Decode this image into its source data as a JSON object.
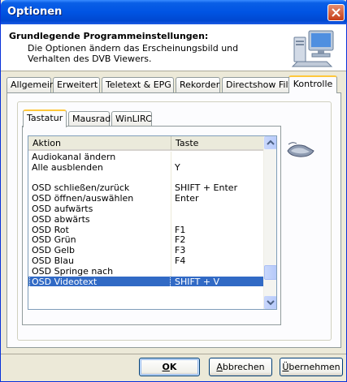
{
  "window": {
    "title": "Optionen",
    "icons": {
      "close": "close-icon",
      "header": "computer-monitor-icon",
      "keyboard": "keyboard-icon"
    }
  },
  "header": {
    "title": "Grundlegende Programmeinstellungen:",
    "description": "Die Optionen ändern das Erscheinungsbild und Verhalten des DVB Viewers."
  },
  "tabs": [
    {
      "label": "Allgemein"
    },
    {
      "label": "Erweitert"
    },
    {
      "label": "Teletext & EPG"
    },
    {
      "label": "Rekorder"
    },
    {
      "label": "Directshow Filter"
    },
    {
      "label": "Kontrolle",
      "active": true
    }
  ],
  "subtabs": [
    {
      "label": "Tastatur",
      "active": true
    },
    {
      "label": "Mausrad"
    },
    {
      "label": "WinLIRC"
    }
  ],
  "list": {
    "columns": [
      "Aktion",
      "Taste"
    ],
    "rows": [
      {
        "action": "Audiokanal ändern",
        "key": ""
      },
      {
        "action": "Alle ausblenden",
        "key": "Y"
      },
      {
        "action": "",
        "key": ""
      },
      {
        "action": "OSD schließen/zurück",
        "key": "SHIFT + Enter"
      },
      {
        "action": "OSD öffnen/auswählen",
        "key": "Enter"
      },
      {
        "action": "OSD aufwärts",
        "key": ""
      },
      {
        "action": "OSD abwärts",
        "key": ""
      },
      {
        "action": "OSD Rot",
        "key": "F1"
      },
      {
        "action": "OSD Grün",
        "key": "F2"
      },
      {
        "action": "OSD Gelb",
        "key": "F3"
      },
      {
        "action": "OSD Blau",
        "key": "F4"
      },
      {
        "action": "OSD Springe nach",
        "key": ""
      },
      {
        "action": "OSD Videotext",
        "key": "SHIFT + V",
        "selected": true
      }
    ],
    "scroll_position": 0.88
  },
  "buttons": {
    "ok": {
      "underlined": "O",
      "rest": "K"
    },
    "cancel": {
      "underlined": "A",
      "rest": "bbrechen"
    },
    "apply": {
      "underlined": "Ü",
      "rest": "bernehmen"
    }
  },
  "colors": {
    "titlebar": "#0054e3",
    "selection": "#316ac5",
    "active_tab_accent": "#ffc83c"
  }
}
